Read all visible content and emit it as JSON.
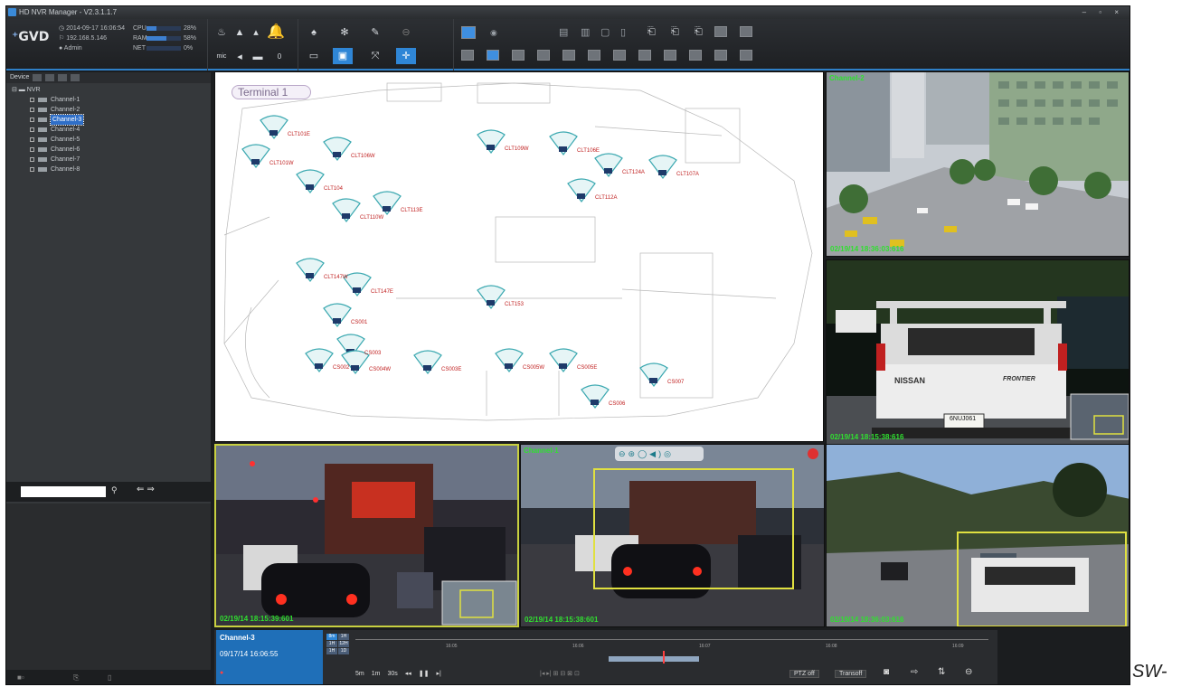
{
  "window": {
    "title": "HD NVR Manager - V2.3.1.1.7"
  },
  "toolbar": {
    "logo": "GVD",
    "datetime": "2014-09-17 16:06:54",
    "ip": "192.168.5.146",
    "user": "Admin",
    "meters": [
      {
        "label": "CPU",
        "value": "28%",
        "fill": 0.28
      },
      {
        "label": "RAM",
        "value": "58%",
        "fill": 0.58
      },
      {
        "label": "NET",
        "value": "0%",
        "fill": 0.0
      }
    ],
    "audio_value": "0"
  },
  "device_panel": {
    "tab_label": "Device",
    "root": "NVR",
    "channels": [
      "Channel-1",
      "Channel-2",
      "Channel-3",
      "Channel-4",
      "Channel-5",
      "Channel-6",
      "Channel-7",
      "Channel-8"
    ],
    "selected_channel": "Channel-3",
    "search_placeholder": ""
  },
  "map": {
    "terminal_label": "Terminal 1",
    "cameras": [
      "CLT101E",
      "CLT101W",
      "CLT104",
      "CLT106W",
      "CLT110W",
      "CLT113E",
      "CLT109W",
      "CLT106E",
      "CLT124A",
      "CLT107A",
      "CLT112A",
      "CLT147W",
      "CLT147E",
      "CS001",
      "CLT153",
      "CS003",
      "CS002",
      "CS004W",
      "CS003E",
      "CS005W",
      "CS005E",
      "CS007",
      "CS006"
    ]
  },
  "views": {
    "channel2_title": "Channel-2",
    "channel1_title": "Channel-1",
    "ts_top_right": "02/19/14 18:36:03:616",
    "ts_mid_right": "02/19/14 18:15:38:616",
    "ts_bottom_left": "02/19/14 18:15:39:601",
    "ts_bottom_mid": "02/19/14 18:15:38:601",
    "ts_bottom_right": "02/19/14 18:36:03:616",
    "truck_plate": "6NUJ061",
    "truck_brand": "NISSAN",
    "truck_model": "FRONTIER"
  },
  "playback": {
    "channel": "Channel-3",
    "timestamp": "09/17/14 16:06:55",
    "scales": [
      [
        "8m",
        "1H"
      ],
      [
        "1H",
        "12H"
      ],
      [
        "1H",
        "1D"
      ]
    ],
    "ticks": [
      "16:05",
      "16:06",
      "16:07",
      "16:08",
      "16:09"
    ],
    "controls": [
      "5m",
      "1m",
      "30s"
    ],
    "ptz_label": "PTZ off",
    "transoff_label": "Transoff"
  },
  "watermark": "SW-"
}
